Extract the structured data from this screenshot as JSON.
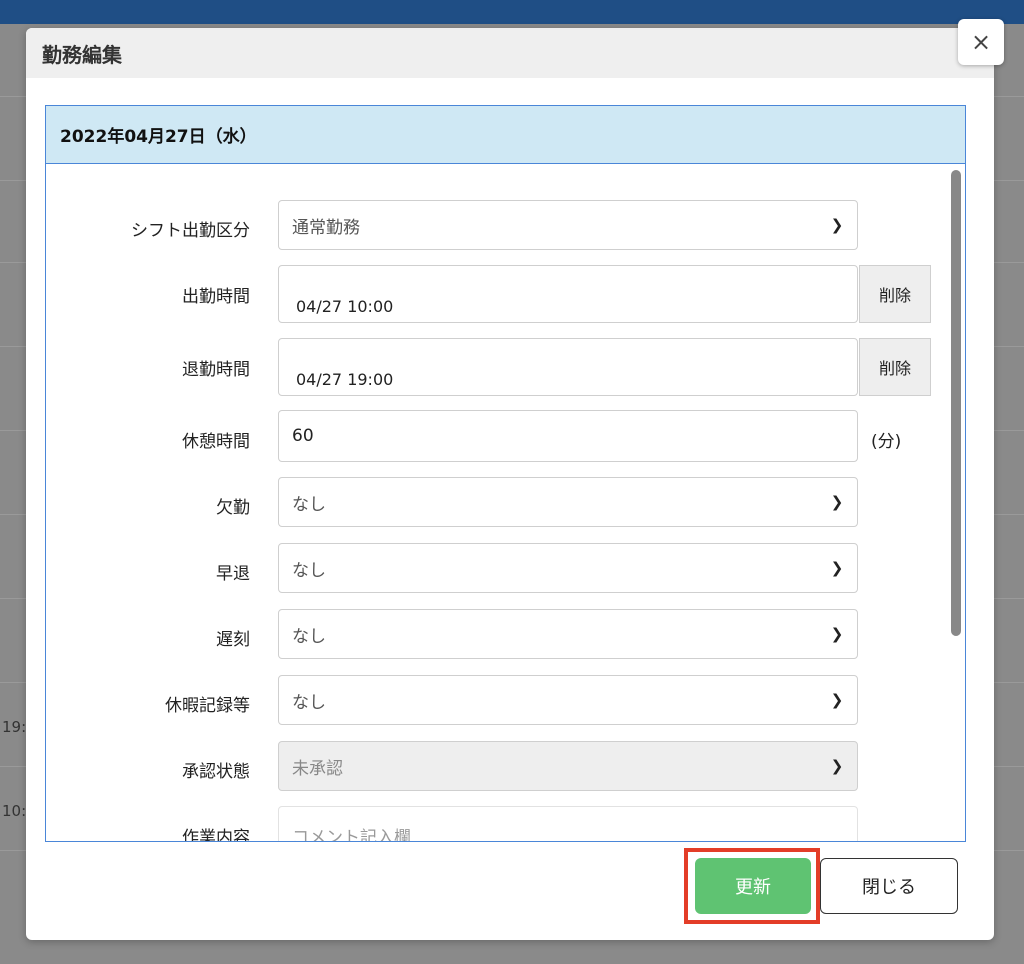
{
  "background": {
    "side_texts": [
      "19:",
      "10:"
    ]
  },
  "modal": {
    "title": "勤務編集",
    "close_symbol": "×",
    "date_header": "2022年04月27日（水）"
  },
  "form": {
    "shift_type": {
      "label": "シフト出勤区分",
      "value": "通常勤務"
    },
    "clock_in": {
      "label": "出勤時間",
      "value": "04/27 10:00",
      "delete_label": "削除"
    },
    "clock_out": {
      "label": "退勤時間",
      "value": "04/27 19:00",
      "delete_label": "削除"
    },
    "break_time": {
      "label": "休憩時間",
      "value": "60",
      "unit": "(分)"
    },
    "absence": {
      "label": "欠勤",
      "value": "なし"
    },
    "early_leave": {
      "label": "早退",
      "value": "なし"
    },
    "late": {
      "label": "遅刻",
      "value": "なし"
    },
    "leave_record": {
      "label": "休暇記録等",
      "value": "なし"
    },
    "approval": {
      "label": "承認状態",
      "value": "未承認"
    },
    "work_content": {
      "label": "作業内容",
      "placeholder": "コメント記入欄"
    }
  },
  "footer": {
    "update_label": "更新",
    "close_label": "閉じる"
  },
  "colors": {
    "update_button": "#5fc372",
    "highlight_border": "#e33d28",
    "panel_header": "#cfe8f4",
    "top_bar": "#1f4e85"
  },
  "icons": {
    "select_indicator": "chevron-down-icon",
    "close": "close-icon"
  }
}
